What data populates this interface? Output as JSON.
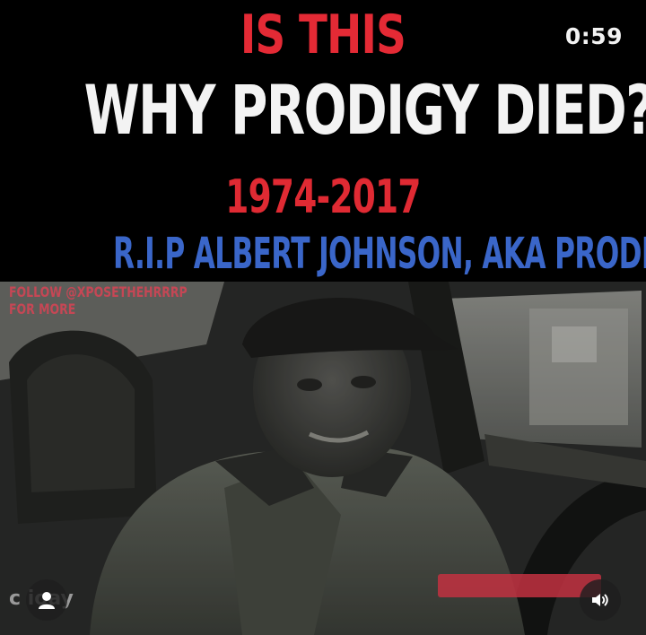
{
  "overlay": {
    "headline_line1": "IS THIS",
    "headline_line2": "WHY PRODIGY DIED?",
    "headline_years": "1974-2017",
    "headline_rip": "R.I.P ALBERT JOHNSON, AKA PRODIGY",
    "follow_line1": "FOLLOW @XPOSETHEHRRRP",
    "follow_line2": "FOR MORE",
    "brand_watermark": "c  ioay"
  },
  "player": {
    "time_remaining": "0:59",
    "user_icon": "person-icon",
    "sound_icon": "speaker-icon"
  },
  "colors": {
    "headline_red": "#e42a35",
    "headline_white": "#f3f3f3",
    "headline_blue": "#3a66c9",
    "follow_pink": "#c54755",
    "control_bg": "#1e1e1e"
  }
}
